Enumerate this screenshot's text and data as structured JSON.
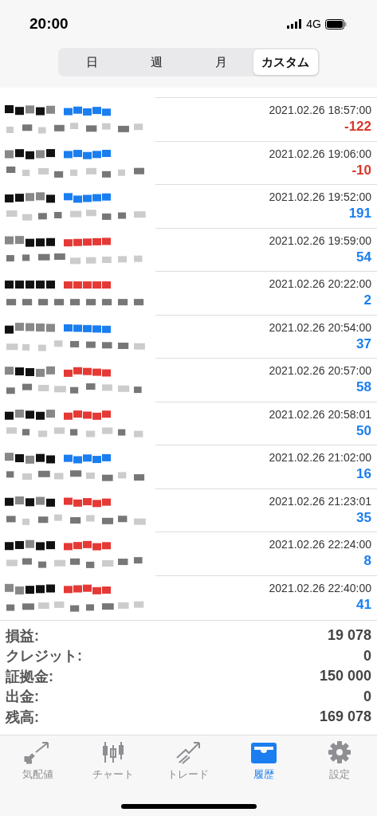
{
  "status_bar": {
    "time": "20:00",
    "network": "4G"
  },
  "segments": [
    {
      "label": "日",
      "selected": false
    },
    {
      "label": "週",
      "selected": false
    },
    {
      "label": "月",
      "selected": false
    },
    {
      "label": "カスタム",
      "selected": true
    }
  ],
  "deals": [
    {
      "time": "2021.02.26 18:57:00",
      "profit": "-122",
      "loss": true,
      "color": "#1a7ef0"
    },
    {
      "time": "2021.02.26 19:06:00",
      "profit": "-10",
      "loss": true,
      "color": "#1a7ef0"
    },
    {
      "time": "2021.02.26 19:52:00",
      "profit": "191",
      "loss": false,
      "color": "#1a7ef0"
    },
    {
      "time": "2021.02.26 19:59:00",
      "profit": "54",
      "loss": false,
      "color": "#e53935"
    },
    {
      "time": "2021.02.26 20:22:00",
      "profit": "2",
      "loss": false,
      "color": "#e53935"
    },
    {
      "time": "2021.02.26 20:54:00",
      "profit": "37",
      "loss": false,
      "color": "#1a7ef0"
    },
    {
      "time": "2021.02.26 20:57:00",
      "profit": "58",
      "loss": false,
      "color": "#e53935"
    },
    {
      "time": "2021.02.26 20:58:01",
      "profit": "50",
      "loss": false,
      "color": "#e53935"
    },
    {
      "time": "2021.02.26 21:02:00",
      "profit": "16",
      "loss": false,
      "color": "#1a7ef0"
    },
    {
      "time": "2021.02.26 21:23:01",
      "profit": "35",
      "loss": false,
      "color": "#e53935"
    },
    {
      "time": "2021.02.26 22:24:00",
      "profit": "8",
      "loss": false,
      "color": "#e53935"
    },
    {
      "time": "2021.02.26 22:40:00",
      "profit": "41",
      "loss": false,
      "color": "#e53935"
    }
  ],
  "summary": [
    {
      "label": "損益:",
      "value": "19 078"
    },
    {
      "label": "クレジット:",
      "value": "0"
    },
    {
      "label": "証拠金:",
      "value": "150 000"
    },
    {
      "label": "出金:",
      "value": "0"
    },
    {
      "label": "残高:",
      "value": "169 078"
    }
  ],
  "tab_bar": [
    {
      "label": "気配値",
      "kind": "quotes",
      "selected": false
    },
    {
      "label": "チャート",
      "kind": "chart",
      "selected": false
    },
    {
      "label": "トレード",
      "kind": "trade",
      "selected": false
    },
    {
      "label": "履歴",
      "kind": "history",
      "selected": true
    },
    {
      "label": "設定",
      "kind": "settings",
      "selected": false
    }
  ]
}
